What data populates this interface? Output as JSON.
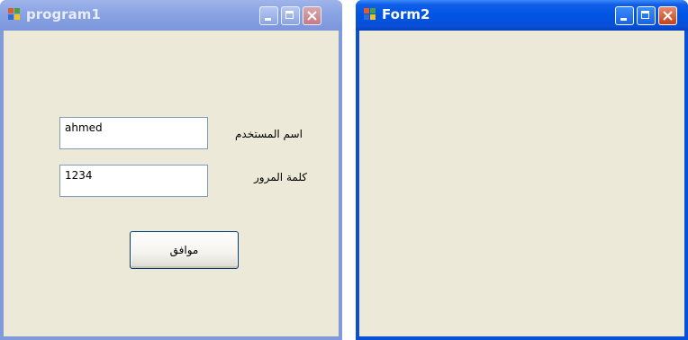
{
  "window1": {
    "title": "program1",
    "username_value": "ahmed",
    "username_label": "اسم المستخدم",
    "password_value": "1234",
    "password_label": "كلمة المرور",
    "ok_button_label": "موافق"
  },
  "window2": {
    "title": "Form2"
  },
  "colors": {
    "active_titlebar": "#0054e3",
    "inactive_titlebar": "#7b96dc",
    "client_background": "#ece9d8",
    "close_button": "#c6411c"
  },
  "icons": [
    "app-icon",
    "minimize-icon",
    "maximize-icon",
    "close-icon"
  ]
}
